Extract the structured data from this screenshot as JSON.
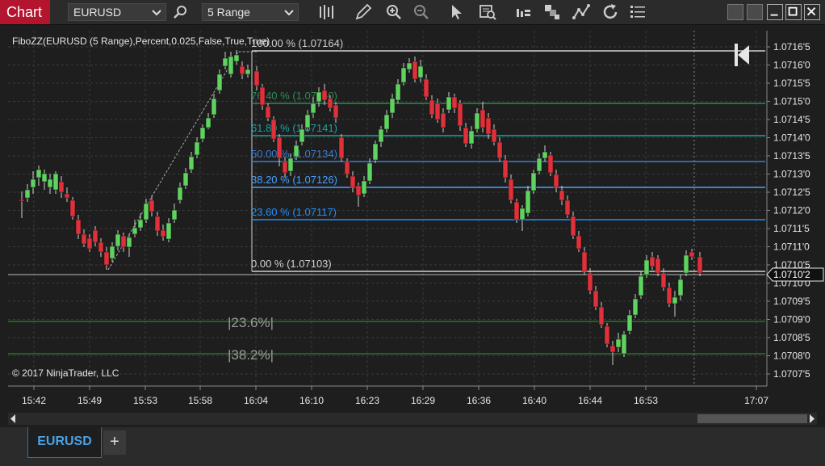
{
  "toolbar": {
    "chart_label": "Chart",
    "instrument": "EURUSD",
    "period": "5 Range",
    "icons": [
      "search-icon",
      "bar-type-icon",
      "draw-pencil-icon",
      "zoom-in-icon",
      "zoom-out-icon",
      "pointer-icon",
      "data-box-icon",
      "strategies-icon",
      "indicators-icon",
      "drawing-tools-icon",
      "reload-icon",
      "properties-icon"
    ]
  },
  "chart": {
    "indicator_label": "FiboZZ(EURUSD (5 Range),Percent,0.025,False,True,True)",
    "copyright": "© 2017 NinjaTrader, LLC",
    "price_ticks": [
      "1.0716'5",
      "1.0716'0",
      "1.0715'5",
      "1.0715'0",
      "1.0714'5",
      "1.0714'0",
      "1.0713'5",
      "1.0713'0",
      "1.0712'5",
      "1.0712'0",
      "1.0711'5",
      "1.0711'0",
      "1.0710'5",
      "1.0710'0",
      "1.0709'5",
      "1.0709'0",
      "1.0708'5",
      "1.0708'0",
      "1.0707'5"
    ],
    "current_price": "1.0710'2",
    "time_ticks": [
      "15:42",
      "15:49",
      "15:53",
      "15:58",
      "16:04",
      "16:10",
      "16:23",
      "16:29",
      "16:36",
      "16:40",
      "16:44",
      "16:53",
      "17:07"
    ],
    "fib_levels": [
      {
        "label": "100.00 % (1.07164)",
        "color": "#d0d0d0"
      },
      {
        "label": "76.40 % (1.07150)",
        "color": "#2e8b57"
      },
      {
        "label": "61.80 % (1.07141)",
        "color": "#20a0a0"
      },
      {
        "label": "50.00 % (1.07134)",
        "color": "#3a7fd0"
      },
      {
        "label": "38.20 % (1.07126)",
        "color": "#4aa0ff"
      },
      {
        "label": "23.60 % (1.07117)",
        "color": "#1e90ff"
      },
      {
        "label": "0.00 % (1.07103)",
        "color": "#d0d0d0"
      }
    ],
    "ext_levels": [
      {
        "label": "|23.6%|",
        "color": "#2fa02f"
      },
      {
        "label": "|38.2%|",
        "color": "#2fa02f"
      }
    ],
    "up_color": "#5fd35f",
    "down_color": "#e0303a"
  },
  "tabs": {
    "active": "EURUSD",
    "add": "+"
  }
}
